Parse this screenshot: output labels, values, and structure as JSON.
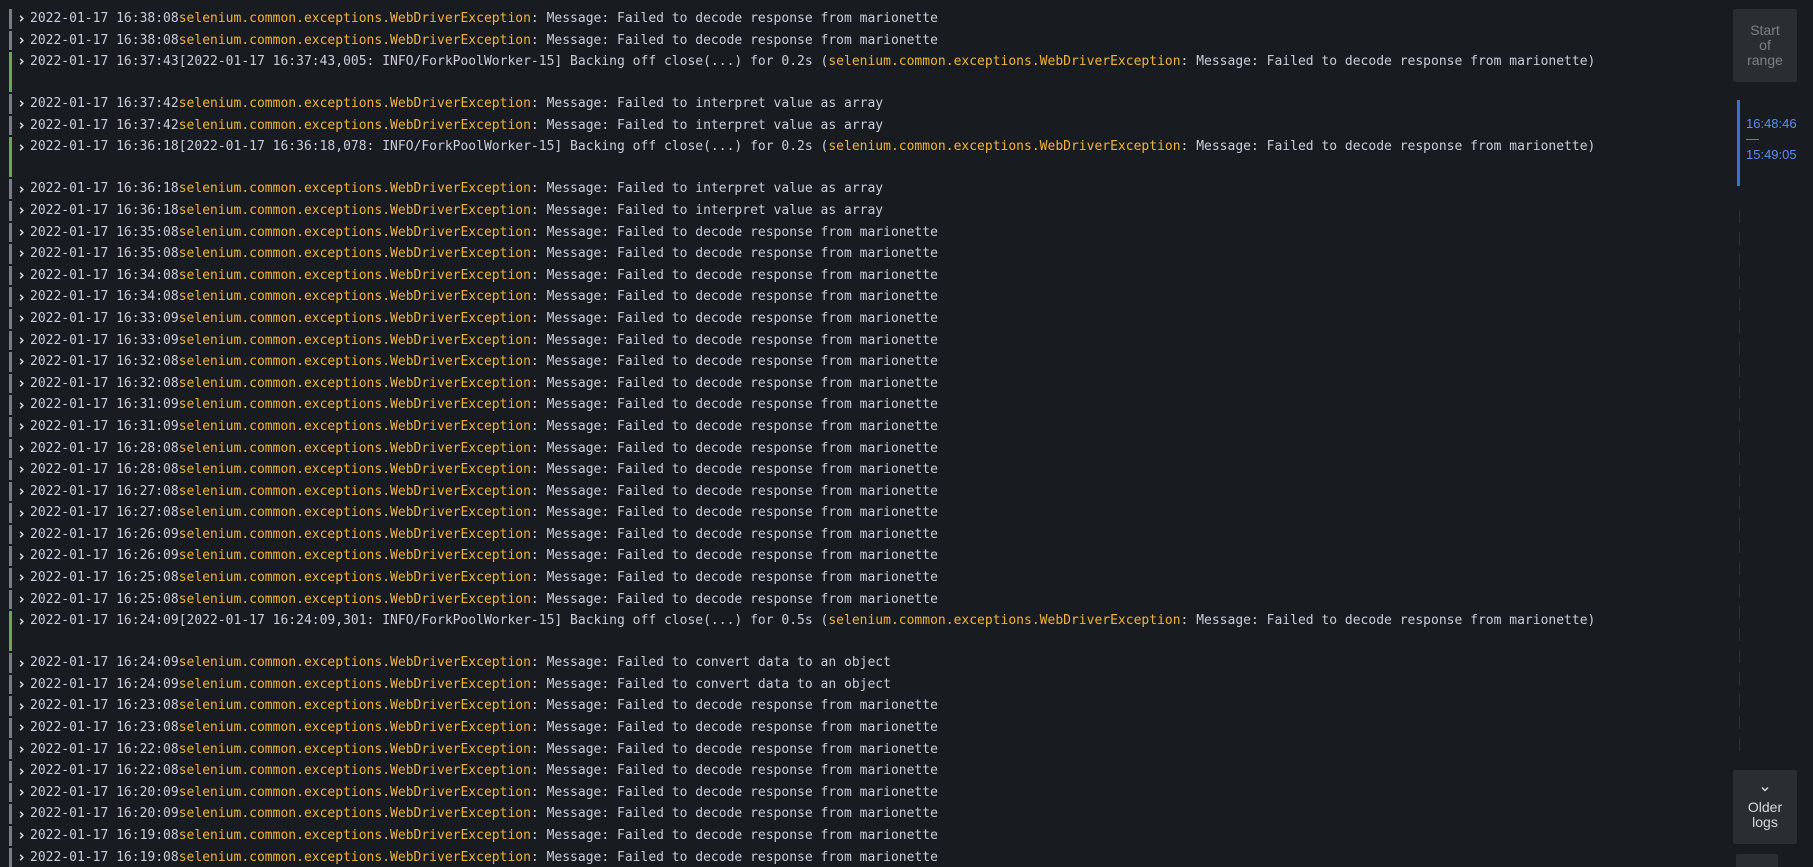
{
  "logs": [
    {
      "time": "2022-01-17 16:38:08",
      "kind": "exc",
      "exc": "selenium.common.exceptions.WebDriverException",
      "msg": ": Message: Failed to decode response from marionette"
    },
    {
      "time": "2022-01-17 16:38:08",
      "kind": "exc",
      "exc": "selenium.common.exceptions.WebDriverException",
      "msg": ": Message: Failed to decode response from marionette"
    },
    {
      "time": "2022-01-17 16:37:43",
      "kind": "info",
      "prefix": "[2022-01-17 16:37:43,005: INFO/ForkPoolWorker-15] Backing off close(...) for 0.2s (",
      "exc": "selenium.common.exceptions.WebDriverException",
      "msg": ": Message: Failed to decode response from marionette)"
    },
    {
      "time": "2022-01-17 16:37:42",
      "kind": "exc",
      "exc": "selenium.common.exceptions.WebDriverException",
      "msg": ": Message: Failed to interpret value as array"
    },
    {
      "time": "2022-01-17 16:37:42",
      "kind": "exc",
      "exc": "selenium.common.exceptions.WebDriverException",
      "msg": ": Message: Failed to interpret value as array"
    },
    {
      "time": "2022-01-17 16:36:18",
      "kind": "info",
      "prefix": "[2022-01-17 16:36:18,078: INFO/ForkPoolWorker-15] Backing off close(...) for 0.2s (",
      "exc": "selenium.common.exceptions.WebDriverException",
      "msg": ": Message: Failed to decode response from marionette)"
    },
    {
      "time": "2022-01-17 16:36:18",
      "kind": "exc",
      "exc": "selenium.common.exceptions.WebDriverException",
      "msg": ": Message: Failed to interpret value as array"
    },
    {
      "time": "2022-01-17 16:36:18",
      "kind": "exc",
      "exc": "selenium.common.exceptions.WebDriverException",
      "msg": ": Message: Failed to interpret value as array"
    },
    {
      "time": "2022-01-17 16:35:08",
      "kind": "exc",
      "exc": "selenium.common.exceptions.WebDriverException",
      "msg": ": Message: Failed to decode response from marionette"
    },
    {
      "time": "2022-01-17 16:35:08",
      "kind": "exc",
      "exc": "selenium.common.exceptions.WebDriverException",
      "msg": ": Message: Failed to decode response from marionette"
    },
    {
      "time": "2022-01-17 16:34:08",
      "kind": "exc",
      "exc": "selenium.common.exceptions.WebDriverException",
      "msg": ": Message: Failed to decode response from marionette"
    },
    {
      "time": "2022-01-17 16:34:08",
      "kind": "exc",
      "exc": "selenium.common.exceptions.WebDriverException",
      "msg": ": Message: Failed to decode response from marionette"
    },
    {
      "time": "2022-01-17 16:33:09",
      "kind": "exc",
      "exc": "selenium.common.exceptions.WebDriverException",
      "msg": ": Message: Failed to decode response from marionette"
    },
    {
      "time": "2022-01-17 16:33:09",
      "kind": "exc",
      "exc": "selenium.common.exceptions.WebDriverException",
      "msg": ": Message: Failed to decode response from marionette"
    },
    {
      "time": "2022-01-17 16:32:08",
      "kind": "exc",
      "exc": "selenium.common.exceptions.WebDriverException",
      "msg": ": Message: Failed to decode response from marionette"
    },
    {
      "time": "2022-01-17 16:32:08",
      "kind": "exc",
      "exc": "selenium.common.exceptions.WebDriverException",
      "msg": ": Message: Failed to decode response from marionette"
    },
    {
      "time": "2022-01-17 16:31:09",
      "kind": "exc",
      "exc": "selenium.common.exceptions.WebDriverException",
      "msg": ": Message: Failed to decode response from marionette"
    },
    {
      "time": "2022-01-17 16:31:09",
      "kind": "exc",
      "exc": "selenium.common.exceptions.WebDriverException",
      "msg": ": Message: Failed to decode response from marionette"
    },
    {
      "time": "2022-01-17 16:28:08",
      "kind": "exc",
      "exc": "selenium.common.exceptions.WebDriverException",
      "msg": ": Message: Failed to decode response from marionette"
    },
    {
      "time": "2022-01-17 16:28:08",
      "kind": "exc",
      "exc": "selenium.common.exceptions.WebDriverException",
      "msg": ": Message: Failed to decode response from marionette"
    },
    {
      "time": "2022-01-17 16:27:08",
      "kind": "exc",
      "exc": "selenium.common.exceptions.WebDriverException",
      "msg": ": Message: Failed to decode response from marionette"
    },
    {
      "time": "2022-01-17 16:27:08",
      "kind": "exc",
      "exc": "selenium.common.exceptions.WebDriverException",
      "msg": ": Message: Failed to decode response from marionette"
    },
    {
      "time": "2022-01-17 16:26:09",
      "kind": "exc",
      "exc": "selenium.common.exceptions.WebDriverException",
      "msg": ": Message: Failed to decode response from marionette"
    },
    {
      "time": "2022-01-17 16:26:09",
      "kind": "exc",
      "exc": "selenium.common.exceptions.WebDriverException",
      "msg": ": Message: Failed to decode response from marionette"
    },
    {
      "time": "2022-01-17 16:25:08",
      "kind": "exc",
      "exc": "selenium.common.exceptions.WebDriverException",
      "msg": ": Message: Failed to decode response from marionette"
    },
    {
      "time": "2022-01-17 16:25:08",
      "kind": "exc",
      "exc": "selenium.common.exceptions.WebDriverException",
      "msg": ": Message: Failed to decode response from marionette"
    },
    {
      "time": "2022-01-17 16:24:09",
      "kind": "info",
      "prefix": "[2022-01-17 16:24:09,301: INFO/ForkPoolWorker-15] Backing off close(...) for 0.5s (",
      "exc": "selenium.common.exceptions.WebDriverException",
      "msg": ": Message: Failed to decode response from marionette)"
    },
    {
      "time": "2022-01-17 16:24:09",
      "kind": "exc",
      "exc": "selenium.common.exceptions.WebDriverException",
      "msg": ": Message: Failed to convert data to an object"
    },
    {
      "time": "2022-01-17 16:24:09",
      "kind": "exc",
      "exc": "selenium.common.exceptions.WebDriverException",
      "msg": ": Message: Failed to convert data to an object"
    },
    {
      "time": "2022-01-17 16:23:08",
      "kind": "exc",
      "exc": "selenium.common.exceptions.WebDriverException",
      "msg": ": Message: Failed to decode response from marionette"
    },
    {
      "time": "2022-01-17 16:23:08",
      "kind": "exc",
      "exc": "selenium.common.exceptions.WebDriverException",
      "msg": ": Message: Failed to decode response from marionette"
    },
    {
      "time": "2022-01-17 16:22:08",
      "kind": "exc",
      "exc": "selenium.common.exceptions.WebDriverException",
      "msg": ": Message: Failed to decode response from marionette"
    },
    {
      "time": "2022-01-17 16:22:08",
      "kind": "exc",
      "exc": "selenium.common.exceptions.WebDriverException",
      "msg": ": Message: Failed to decode response from marionette"
    },
    {
      "time": "2022-01-17 16:20:09",
      "kind": "exc",
      "exc": "selenium.common.exceptions.WebDriverException",
      "msg": ": Message: Failed to decode response from marionette"
    },
    {
      "time": "2022-01-17 16:20:09",
      "kind": "exc",
      "exc": "selenium.common.exceptions.WebDriverException",
      "msg": ": Message: Failed to decode response from marionette"
    },
    {
      "time": "2022-01-17 16:19:08",
      "kind": "exc",
      "exc": "selenium.common.exceptions.WebDriverException",
      "msg": ": Message: Failed to decode response from marionette"
    },
    {
      "time": "2022-01-17 16:19:08",
      "kind": "exc",
      "exc": "selenium.common.exceptions.WebDriverException",
      "msg": ": Message: Failed to decode response from marionette"
    }
  ],
  "side": {
    "start_line1": "Start",
    "start_line2": "of",
    "start_line3": "range",
    "range_end": "16:48:46",
    "range_sep": "—",
    "range_start": "15:49:05",
    "older_line1": "Older",
    "older_line2": "logs"
  },
  "colors": {
    "background": "#181b1f",
    "text": "#ccccdc",
    "exception": "#f2b33d",
    "level_unknown": "#7a7d85",
    "level_info": "#6ca84f",
    "range_accent": "#3d71d9"
  },
  "icons": {
    "row_expand": "chevron-right-icon",
    "older": "chevron-down-icon"
  }
}
